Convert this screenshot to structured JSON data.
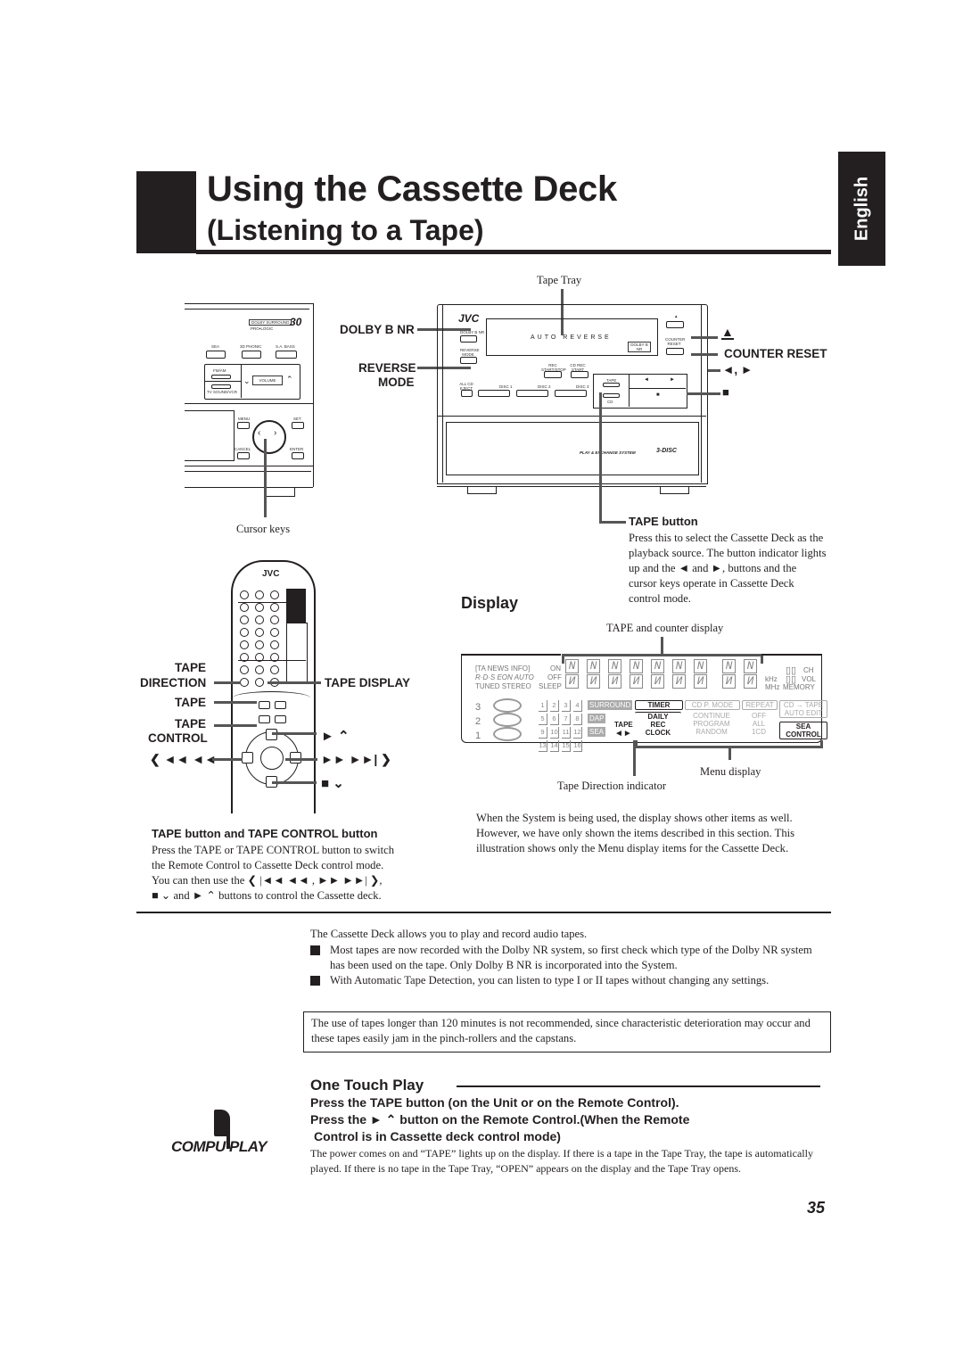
{
  "header": {
    "title": "Using the Cassette Deck",
    "subtitle": "(Listening to a Tape)",
    "language_tab": "English"
  },
  "unit_diagram": {
    "callouts": {
      "tape_tray": "Tape Tray",
      "dolby_b_nr": "DOLBY B NR",
      "reverse_mode_1": "REVERSE",
      "reverse_mode_2": "MODE",
      "eject": "▲",
      "counter_reset": "COUNTER RESET",
      "rew_ff": "◄, ►",
      "stop": "■",
      "cursor_keys": "Cursor keys",
      "tape_button": "TAPE button"
    },
    "panel_labels": {
      "jvc": "JVC",
      "auto_reverse": "AUTO REVERSE",
      "dolby_surround": "DOLBY SURROUND",
      "pro_logic": "PRO•LOGIC",
      "sea": "SEA",
      "phonic": "3D PHONIC",
      "bass": "S.A. BASS",
      "fm_am": "FM/AM",
      "tv_sound": "TV SOUND/VCR",
      "volume": "VOLUME",
      "menu": "MENU",
      "set": "SET",
      "cancel": "CANCEL",
      "enter": "ENTER",
      "dolby_nr_btn": "DOLBY B NR",
      "reverse_btn": "REVERSE MODE",
      "rec_start": "REC START/STOP",
      "cd_rec": "CD REC START",
      "all_cd": "ALL CD EJECT",
      "disc1": "DISC 1",
      "disc2": "DISC 2",
      "disc3": "DISC 3",
      "tape": "TAPE",
      "cd": "CD",
      "counter_reset_btn": "COUNTER RESET",
      "play_exchange": "PLAY & EXCHANGE SYSTEM",
      "three_disc": "3-DISC"
    }
  },
  "tape_button_desc": "Press this to select the Cassette Deck as the playback source. The button indicator lights up and the ◄ and ►, buttons and the cursor keys operate in Cassette Deck control mode.",
  "remote_diagram": {
    "brand": "JVC",
    "callouts": {
      "tape_direction_1": "TAPE",
      "tape_direction_2": "DIRECTION",
      "tape_display": "TAPE DISPLAY",
      "tape": "TAPE",
      "tape_control_1": "TAPE",
      "tape_control_2": "CONTROL",
      "play_up": "► ⌃",
      "rew_left": "❮ ◄◄ ◄◄",
      "ff_right": "►► ►►| ❯",
      "stop_down": "■ ⌄"
    }
  },
  "remote_section": {
    "heading": "TAPE button and TAPE CONTROL button",
    "line1": "Press the TAPE or TAPE CONTROL button to switch",
    "line2": "the Remote Control to Cassette Deck control mode.",
    "line3": "You can then use the ❮ |◄◄ ◄◄ , ►► ►►| ❯,",
    "line4": "■ ⌄ and ► ⌃ buttons to control the Cassette deck."
  },
  "display_section": {
    "heading": "Display",
    "counter_caption": "TAPE and counter display",
    "lcd": {
      "ta_news_info": "[TA NEWS INFO]",
      "rds": "R·D·S EON AUTO",
      "tuned_stereo": "TUNED STEREO",
      "on": "ON",
      "off": "OFF",
      "sleep": "SLEEP",
      "khz": "kHz",
      "mhz": "MHz",
      "ch": "CH",
      "vol": "VOL",
      "memory": "MEMORY",
      "numbers": [
        "1",
        "2",
        "3",
        "4",
        "5",
        "6",
        "7",
        "8",
        "9",
        "10",
        "11",
        "12",
        "13",
        "14",
        "15",
        "16"
      ],
      "surround": "SURROUND",
      "dap": "DAP",
      "sea": "SEA",
      "tape": "TAPE",
      "direction": "◄►",
      "menu": [
        {
          "top": "TIMER",
          "bottom": "DAILY\nREC\nCLOCK",
          "active": true
        },
        {
          "top": "CD P. MODE",
          "bottom": "CONTINUE\nPROGRAM\nRANDOM",
          "active": false
        },
        {
          "top": "REPEAT",
          "bottom": "OFF\nALL\n1CD",
          "active": false
        },
        {
          "top": "CD → TAPE\nAUTO EDIT",
          "bottom": "SEA\nCONTROL",
          "active": true
        }
      ]
    },
    "menu_caption": "Menu display",
    "direction_caption": "Tape Direction indicator",
    "note": "When the System is being used, the display shows other items as well. However, we have only shown the items described in this section. This illustration shows only the Menu display items for the Cassette Deck."
  },
  "intro": {
    "line": "The Cassette Deck allows you to play and record audio tapes.",
    "bullets": [
      "Most tapes are now recorded with the Dolby NR system, so first check which type of the Dolby NR system has been used on the tape. Only Dolby B NR is incorporated into the System.",
      "With Automatic Tape Detection, you can listen to type I or II tapes without changing any settings."
    ]
  },
  "warning_box": "The use of tapes longer than 120 minutes is not recommended, since characteristic deterioration may occur and these tapes easily jam in the pinch-rollers and the capstans.",
  "one_touch": {
    "heading": "One Touch Play",
    "logo": "COMPU PLAY",
    "step1": "Press the TAPE button (on the Unit or on the Remote Control).",
    "step2a": "Press the ► ⌃ button on the Remote Control.(When the Remote",
    "step2b": "Control is in Cassette deck control mode)",
    "body": "The power comes on and “TAPE” lights up on the display. If there is a tape in the Tape Tray, the tape is automatically played. If there is no tape in the Tape Tray, “OPEN” appears on the display and the Tape Tray opens."
  },
  "page_number": "35"
}
